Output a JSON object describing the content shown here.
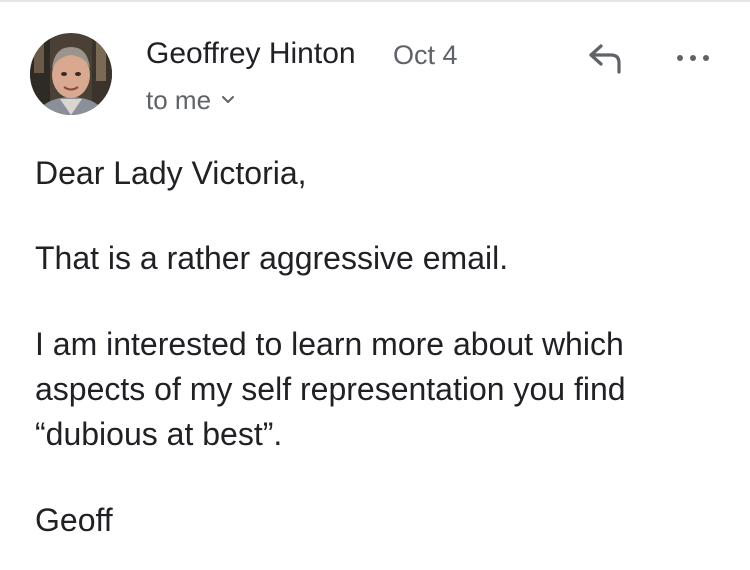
{
  "email": {
    "sender": {
      "name": "Geoffrey Hinton",
      "avatar": "sender-avatar-photo"
    },
    "date": "Oct 4",
    "recipient_label": "to me",
    "icons": {
      "recipient_toggle": "chevron-down-icon",
      "reply": "reply-icon",
      "more": "more-options-icon"
    },
    "body": {
      "greeting": "Dear Lady Victoria,",
      "paragraph1": "That is a rather aggressive email.",
      "paragraph2_lines": [
        "I am interested to learn more about which",
        "aspects of my self representation you find",
        "“dubious at best”."
      ],
      "signoff": "Geoff"
    }
  },
  "colors": {
    "primary_text": "#202124",
    "secondary_text": "#5f6368",
    "icon": "#5f6368",
    "background": "#ffffff"
  }
}
